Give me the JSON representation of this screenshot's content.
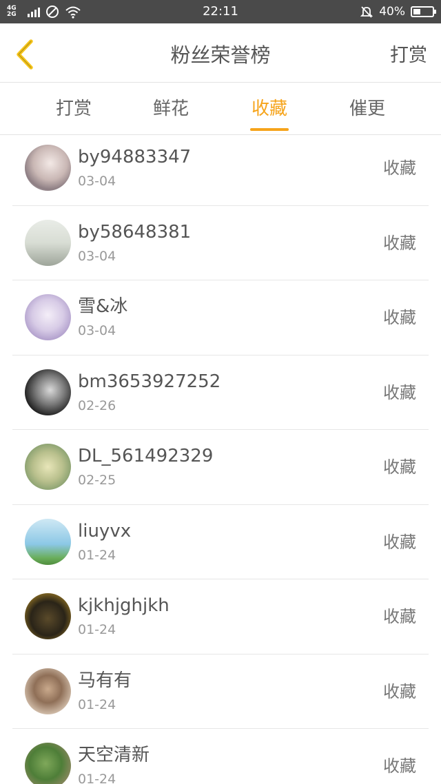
{
  "status_bar": {
    "network": "4G 2G",
    "time": "22:11",
    "battery": "40%",
    "battery_level": 0.4
  },
  "header": {
    "title": "粉丝荣誉榜",
    "action": "打赏",
    "back_icon": "chevron-left-icon",
    "accent_color": "#f6a41b"
  },
  "tabs": [
    {
      "label": "打赏",
      "active": false
    },
    {
      "label": "鲜花",
      "active": false
    },
    {
      "label": "收藏",
      "active": true
    },
    {
      "label": "催更",
      "active": false
    }
  ],
  "fans": [
    {
      "name": "by94883347",
      "date": "03-04",
      "action": "收藏"
    },
    {
      "name": "by58648381",
      "date": "03-04",
      "action": "收藏"
    },
    {
      "name": "雪&冰",
      "date": "03-04",
      "action": "收藏"
    },
    {
      "name": "bm3653927252",
      "date": "02-26",
      "action": "收藏"
    },
    {
      "name": "DL_561492329",
      "date": "02-25",
      "action": "收藏"
    },
    {
      "name": "liuyvx",
      "date": "01-24",
      "action": "收藏"
    },
    {
      "name": "kjkhjghjkh",
      "date": "01-24",
      "action": "收藏"
    },
    {
      "name": "马有有",
      "date": "01-24",
      "action": "收藏"
    },
    {
      "name": "天空清新",
      "date": "01-24",
      "action": "收藏"
    }
  ]
}
